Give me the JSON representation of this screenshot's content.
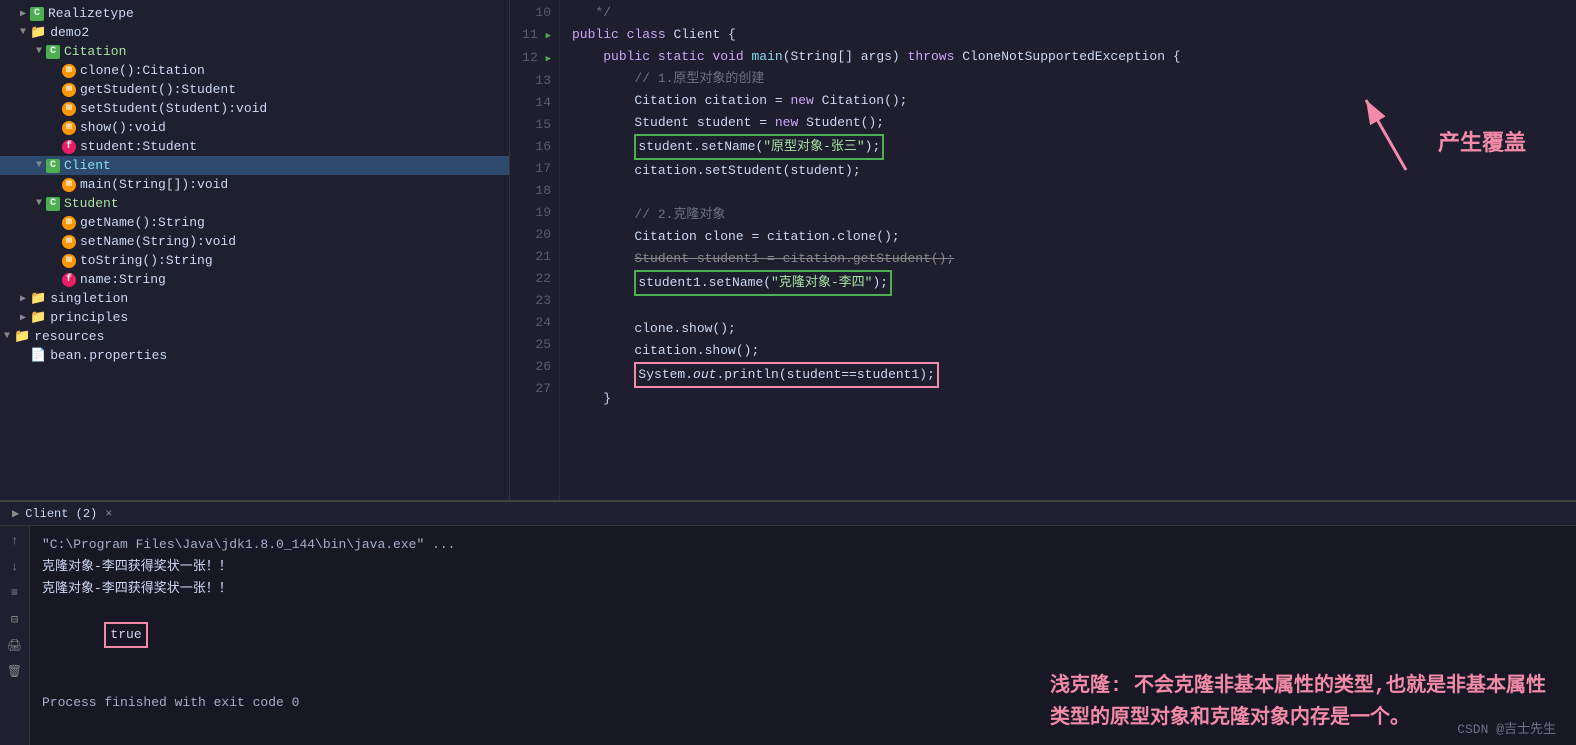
{
  "sidebar": {
    "items": [
      {
        "id": "realizetype",
        "label": "Realizetype",
        "indent": 1,
        "type": "folder",
        "arrow": "closed"
      },
      {
        "id": "demo2",
        "label": "demo2",
        "indent": 1,
        "type": "folder",
        "arrow": "open"
      },
      {
        "id": "citation",
        "label": "Citation",
        "indent": 2,
        "type": "class-c",
        "arrow": "open"
      },
      {
        "id": "clone-citation",
        "label": "clone():Citation",
        "indent": 3,
        "type": "method-m"
      },
      {
        "id": "getstudent",
        "label": "getStudent():Student",
        "indent": 3,
        "type": "method-m"
      },
      {
        "id": "setstudent",
        "label": "setStudent(Student):void",
        "indent": 3,
        "type": "method-m"
      },
      {
        "id": "show",
        "label": "show():void",
        "indent": 3,
        "type": "method-m"
      },
      {
        "id": "student-field",
        "label": "student:Student",
        "indent": 3,
        "type": "field-f"
      },
      {
        "id": "client",
        "label": "Client",
        "indent": 2,
        "type": "class-c",
        "arrow": "open",
        "selected": true
      },
      {
        "id": "main",
        "label": "main(String[]):void",
        "indent": 3,
        "type": "method-m"
      },
      {
        "id": "student-class",
        "label": "Student",
        "indent": 2,
        "type": "class-c",
        "arrow": "open"
      },
      {
        "id": "getname",
        "label": "getName():String",
        "indent": 3,
        "type": "method-m"
      },
      {
        "id": "setname",
        "label": "setName(String):void",
        "indent": 3,
        "type": "method-m"
      },
      {
        "id": "tostring",
        "label": "toString():String",
        "indent": 3,
        "type": "method-m"
      },
      {
        "id": "name-field",
        "label": "name:String",
        "indent": 3,
        "type": "field-f"
      },
      {
        "id": "singletion",
        "label": "singletion",
        "indent": 1,
        "type": "folder",
        "arrow": "closed"
      },
      {
        "id": "principles",
        "label": "principles",
        "indent": 1,
        "type": "folder",
        "arrow": "closed"
      },
      {
        "id": "resources",
        "label": "resources",
        "indent": 0,
        "type": "folder",
        "arrow": "open"
      },
      {
        "id": "bean-properties",
        "label": "bean.properties",
        "indent": 1,
        "type": "file"
      }
    ]
  },
  "code": {
    "lines": [
      {
        "num": 10,
        "content": "   */"
      },
      {
        "num": 11,
        "content": "public class Client {",
        "runnable": true
      },
      {
        "num": 12,
        "content": "    public static void main(String[] args) throws CloneNotSupportedException {",
        "runnable": true
      },
      {
        "num": 13,
        "content": "        // 1.原型对象的创建"
      },
      {
        "num": 14,
        "content": "        Citation citation = new Citation();"
      },
      {
        "num": 15,
        "content": "        Student student = new Student();"
      },
      {
        "num": 16,
        "content": "        student.setName(\"原型对象-张三\");",
        "highlight": "green"
      },
      {
        "num": 17,
        "content": "        citation.setStudent(student);"
      },
      {
        "num": 18,
        "content": ""
      },
      {
        "num": 19,
        "content": "        // 2.克隆对象"
      },
      {
        "num": 20,
        "content": "        Citation clone = citation.clone();"
      },
      {
        "num": 21,
        "content": "        Student student1 = citation.getStudent();"
      },
      {
        "num": 22,
        "content": "        student1.setName(\"克隆对象-李四\");",
        "highlight": "green"
      },
      {
        "num": 23,
        "content": ""
      },
      {
        "num": 24,
        "content": "        clone.show();"
      },
      {
        "num": 25,
        "content": "        citation.show();"
      },
      {
        "num": 26,
        "content": "        System.out.println(student==student1);",
        "highlight": "red"
      },
      {
        "num": 27,
        "content": "    }"
      }
    ]
  },
  "annotation": {
    "cover_text": "产生覆盖",
    "shallow_title": "浅克隆: 不会克隆非基本属性的类型,也就是非基本属性",
    "shallow_body": "类型的原型对象和克隆对象内存是一个。"
  },
  "terminal": {
    "tab_label": "Client (2)",
    "close_label": "×",
    "lines": [
      {
        "type": "path",
        "content": "\"C:\\Program Files\\Java\\jdk1.8.0_144\\bin\\java.exe\" ..."
      },
      {
        "type": "text",
        "content": "克隆对象-李四获得奖状一张！！"
      },
      {
        "type": "text",
        "content": "克隆对象-李四获得奖状一张！！"
      },
      {
        "type": "true",
        "content": "true"
      },
      {
        "type": "text",
        "content": ""
      },
      {
        "type": "process",
        "content": "Process finished with exit code 0"
      }
    ]
  },
  "watermark": "CSDN @吉士先生"
}
